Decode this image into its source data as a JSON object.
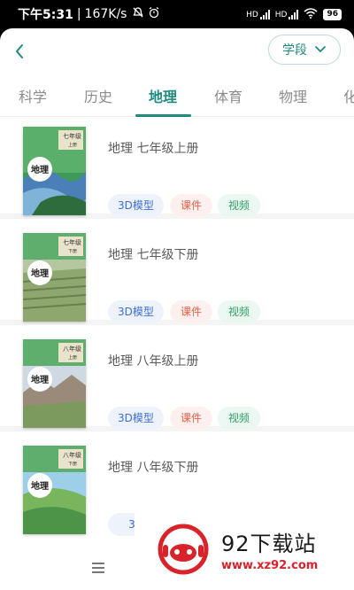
{
  "status_bar": {
    "time": "下午5:31",
    "speed": "167K/s",
    "net1": "HD",
    "net2": "HD",
    "battery": "96"
  },
  "header": {
    "back_icon": "chevron-left-icon",
    "grade_label": "学段",
    "grade_icon": "chevron-down-icon"
  },
  "tabs": [
    {
      "label": "科学"
    },
    {
      "label": "历史"
    },
    {
      "label": "地理",
      "active": true
    },
    {
      "label": "体育"
    },
    {
      "label": "物理"
    },
    {
      "label": "化"
    }
  ],
  "books": [
    {
      "cover_subject": "地理",
      "cover_grade": "七年级",
      "cover_term": "上册",
      "title": "地理 七年级上册"
    },
    {
      "cover_subject": "地理",
      "cover_grade": "七年级",
      "cover_term": "下册",
      "title": "地理 七年级下册"
    },
    {
      "cover_subject": "地理",
      "cover_grade": "八年级",
      "cover_term": "上册",
      "title": "地理 八年级上册"
    },
    {
      "cover_subject": "地理",
      "cover_grade": "八年级",
      "cover_term": "下册",
      "title": "地理 八年级下册"
    }
  ],
  "chips": {
    "model_3d": "3D模型",
    "courseware": "课件",
    "video": "视频",
    "partial_3d": "3D"
  },
  "watermark": {
    "title": "92下载站",
    "url": "www.xz92.com"
  },
  "colors": {
    "accent": "#1e8a80",
    "chip_3d": "#3c6fd0",
    "chip_courseware": "#e2624a",
    "chip_video": "#2f9e68"
  }
}
